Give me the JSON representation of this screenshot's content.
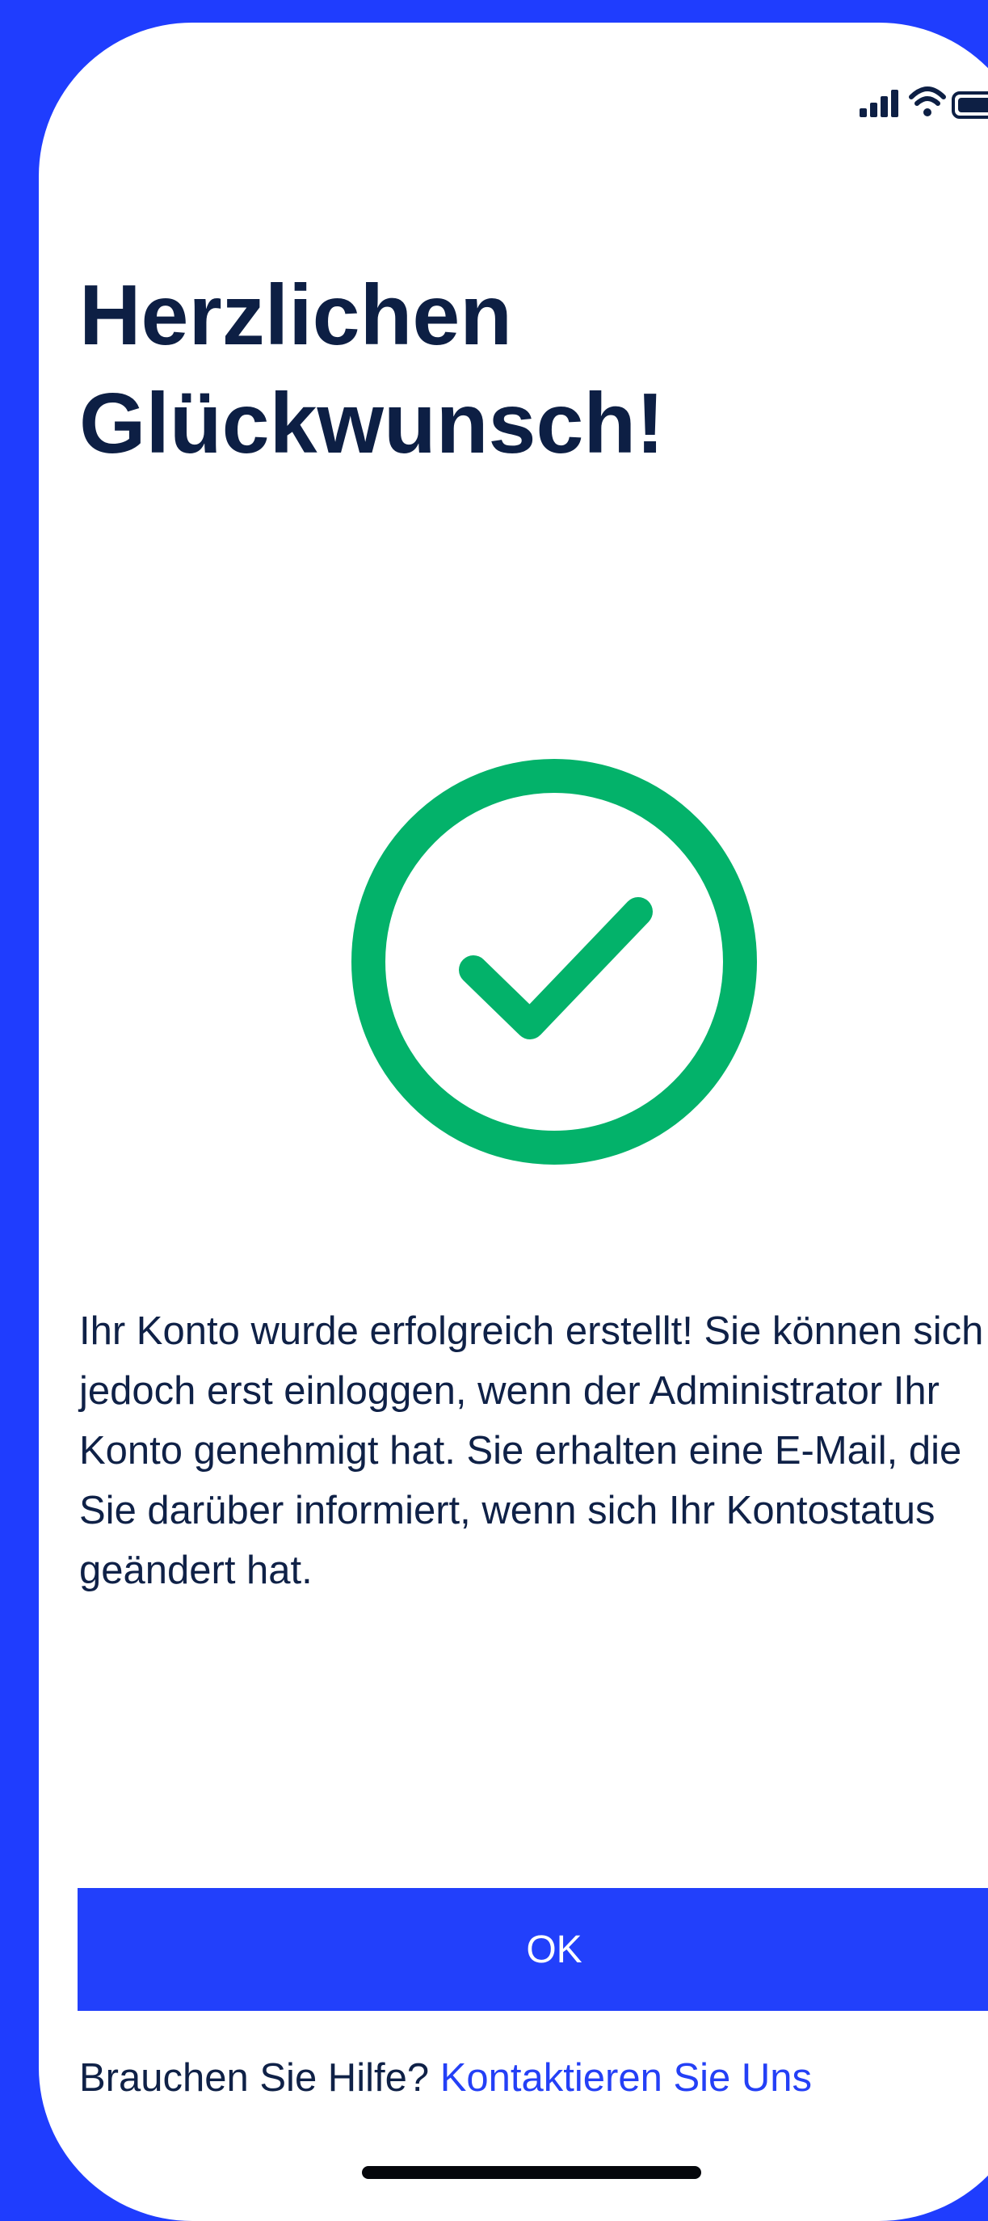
{
  "status_bar": {
    "icons": [
      "signal-icon",
      "wifi-icon",
      "battery-icon"
    ]
  },
  "title": "Herzlichen\nGlückwunsch!",
  "success_icon": "checkmark-circle-icon",
  "message": "Ihr Konto wurde erfolgreich erstellt! Sie können sich jedoch erst einloggen, wenn der Administrator Ihr Konto genehmigt hat. Sie erhalten eine E-Mail, die Sie darüber informiert, wenn sich Ihr Kontostatus geändert hat.",
  "ok_button": "OK",
  "help": {
    "prompt": "Brauchen Sie Hilfe?",
    "link": "Kontaktieren Sie Uns"
  },
  "colors": {
    "background": "#1f3dfe",
    "accent": "#2240fb",
    "success": "#03b26a",
    "text": "#0d1f44"
  }
}
